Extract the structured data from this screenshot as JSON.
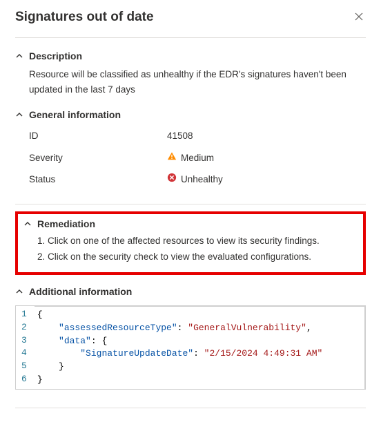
{
  "title": "Signatures out of date",
  "sections": {
    "description": {
      "heading": "Description",
      "body": "Resource will be classified as unhealthy if the EDR's signatures haven't been updated in the last 7 days"
    },
    "general": {
      "heading": "General information",
      "rows": {
        "id": {
          "label": "ID",
          "value": "41508"
        },
        "severity": {
          "label": "Severity",
          "value": "Medium",
          "icon": "warning"
        },
        "status": {
          "label": "Status",
          "value": "Unhealthy",
          "icon": "error"
        }
      }
    },
    "remediation": {
      "heading": "Remediation",
      "steps": {
        "0": "1. Click on one of the affected resources to view its security findings.",
        "1": "2. Click on the security check to view the evaluated configurations."
      }
    },
    "additional": {
      "heading": "Additional information",
      "json": {
        "key1": "\"assessedResourceType\"",
        "val1": "\"GeneralVulnerability\"",
        "key2": "\"data\"",
        "key3": "\"SignatureUpdateDate\"",
        "val3": "\"2/15/2024 4:49:31 AM\""
      },
      "lineNumbers": {
        "1": "1",
        "2": "2",
        "3": "3",
        "4": "4",
        "5": "5",
        "6": "6"
      }
    }
  }
}
